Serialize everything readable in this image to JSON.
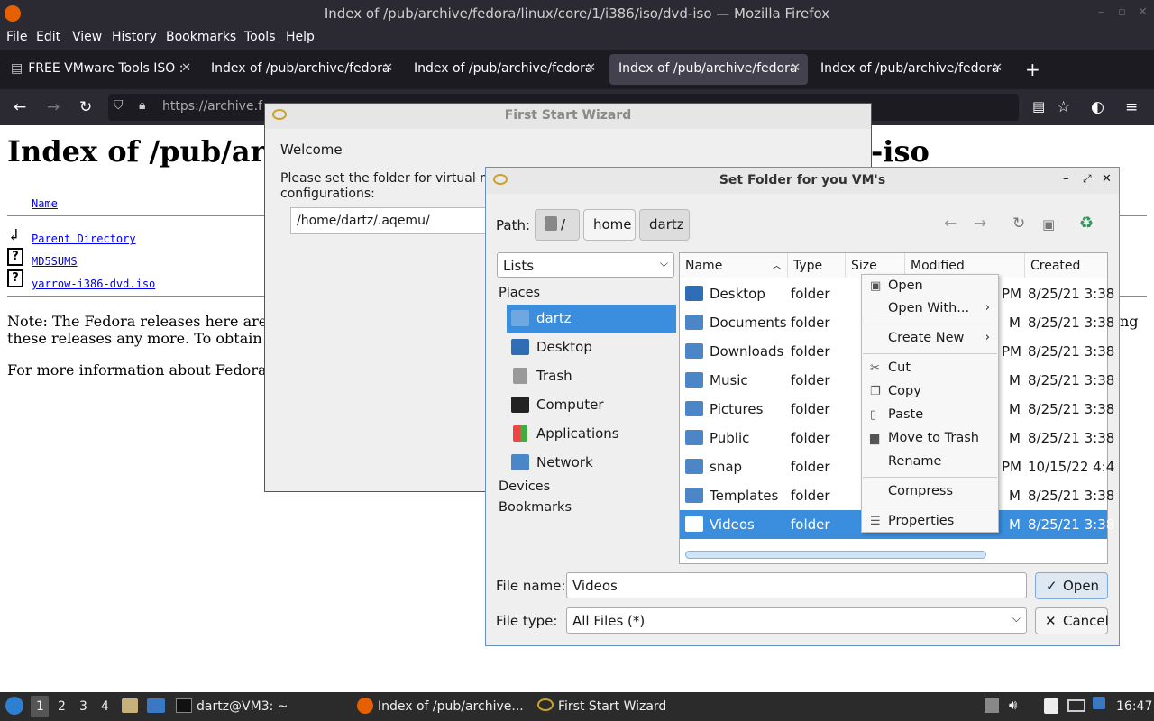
{
  "window": {
    "title": "Index of /pub/archive/fedora/linux/core/1/i386/iso/dvd-iso — Mozilla Firefox"
  },
  "menubar": [
    "File",
    "Edit",
    "View",
    "History",
    "Bookmarks",
    "Tools",
    "Help"
  ],
  "tabs": [
    {
      "label": "FREE VMware Tools ISO :"
    },
    {
      "label": "Index of /pub/archive/fedora"
    },
    {
      "label": "Index of /pub/archive/fedora"
    },
    {
      "label": "Index of /pub/archive/fedora"
    },
    {
      "label": "Index of /pub/archive/fedora"
    }
  ],
  "url": "https://archive.f",
  "page": {
    "heading_left": "Index of /pub/ar",
    "heading_right": "-iso",
    "col_name": "Name",
    "links": [
      "Parent Directory",
      "MD5SUMS",
      "yarrow-i386-dvd.iso"
    ],
    "note1": "Note: The Fedora releases here are",
    "note1_right": "ng",
    "note2": "these releases any more. To obtain",
    "note3": "For more information about Fedora"
  },
  "wizard": {
    "title": "First Start Wizard",
    "welcome": "Welcome",
    "prompt_line1": "Please set the folder for virtual m",
    "prompt_line2": "configurations:",
    "folder_value": "/home/dartz/.aqemu/"
  },
  "dialog": {
    "title": "Set Folder for you VM's",
    "path_label": "Path:",
    "path_parts": [
      "/",
      "home",
      "dartz"
    ],
    "lists_combo": "Lists",
    "places_header": "Places",
    "places": [
      "dartz",
      "Desktop",
      "Trash",
      "Computer",
      "Applications",
      "Network"
    ],
    "devices": "Devices",
    "bookmarks": "Bookmarks",
    "columns": [
      "Name",
      "Type",
      "Size",
      "Modified",
      "Created"
    ],
    "files": [
      {
        "name": "Desktop",
        "type": "folder",
        "mod": "PM",
        "created": "8/25/21 3:38"
      },
      {
        "name": "Documents",
        "type": "folder",
        "mod": "M",
        "created": "8/25/21 3:38"
      },
      {
        "name": "Downloads",
        "type": "folder",
        "mod": "PM",
        "created": "8/25/21 3:38"
      },
      {
        "name": "Music",
        "type": "folder",
        "mod": "M",
        "created": "8/25/21 3:38"
      },
      {
        "name": "Pictures",
        "type": "folder",
        "mod": "M",
        "created": "8/25/21 3:38"
      },
      {
        "name": "Public",
        "type": "folder",
        "mod": "M",
        "created": "8/25/21 3:38"
      },
      {
        "name": "snap",
        "type": "folder",
        "mod": "PM",
        "created": "10/15/22 4:4"
      },
      {
        "name": "Templates",
        "type": "folder",
        "mod": "M",
        "created": "8/25/21 3:38"
      },
      {
        "name": "Videos",
        "type": "folder",
        "mod": "M",
        "created": "8/25/21 3:38"
      }
    ],
    "filename_label": "File name:",
    "filename_value": "Videos",
    "filetype_label": "File type:",
    "filetype_value": "All Files (*)",
    "open_button": "Open",
    "cancel_button": "Cancel"
  },
  "context_menu": {
    "items": [
      "Open",
      "Open With...",
      "Create New",
      "Cut",
      "Copy",
      "Paste",
      "Move to Trash",
      "Rename",
      "Compress",
      "Properties"
    ]
  },
  "taskbar": {
    "workspaces": [
      "1",
      "2",
      "3",
      "4"
    ],
    "tasks": [
      "dartz@VM3: ~",
      "Index of /pub/archive...",
      "First Start Wizard"
    ],
    "clock": "16:47"
  },
  "colors": {
    "accent": "#3b8ede",
    "firefox_bg": "#2b2a33",
    "taskbar": "#2b2b2b"
  }
}
